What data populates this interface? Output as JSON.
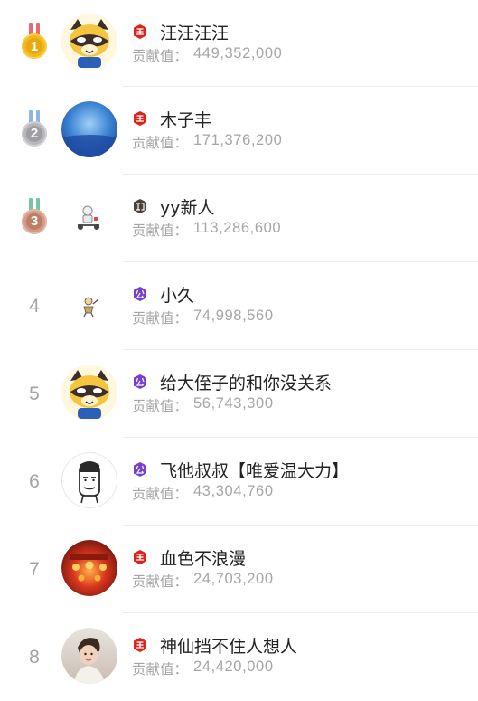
{
  "contribution_label": "贡献值：",
  "entries": [
    {
      "rank": "1",
      "medal": "gold",
      "badge": "king-badge-icon",
      "badge_color": "#d9251d",
      "name": "汪汪汪汪",
      "value": "449,352,000",
      "avatar": "raccoon-mascot-avatar"
    },
    {
      "rank": "2",
      "medal": "silver",
      "badge": "king-badge-icon",
      "badge_color": "#d9251d",
      "name": "木子丰",
      "value": "171,376,200",
      "avatar": "blue-sky-avatar"
    },
    {
      "rank": "3",
      "medal": "bronze",
      "badge": "knight-badge-icon",
      "badge_color": "#4a3f3a",
      "name": "yy新人",
      "value": "113,286,600",
      "avatar": "cartoon-rider-avatar"
    },
    {
      "rank": "4",
      "medal": "",
      "badge": "duke-badge-icon",
      "badge_color": "#7a3fcf",
      "name": "小久",
      "value": "74,998,560",
      "avatar": "cartoon-figure-avatar"
    },
    {
      "rank": "5",
      "medal": "",
      "badge": "duke-badge-icon",
      "badge_color": "#7a3fcf",
      "name": "给大侄子的和你没关系",
      "value": "56,743,300",
      "avatar": "raccoon-mascot-avatar"
    },
    {
      "rank": "6",
      "medal": "",
      "badge": "duke-badge-icon",
      "badge_color": "#7a3fcf",
      "name": "飞他叔叔【唯爱温大力】",
      "value": "43,304,760",
      "avatar": "sketch-face-avatar"
    },
    {
      "rank": "7",
      "medal": "",
      "badge": "king-badge-icon",
      "badge_color": "#d9251d",
      "name": "血色不浪漫",
      "value": "24,703,200",
      "avatar": "red-lanterns-avatar"
    },
    {
      "rank": "8",
      "medal": "",
      "badge": "king-badge-icon",
      "badge_color": "#d9251d",
      "name": "神仙挡不住人想人",
      "value": "24,420,000",
      "avatar": "child-photo-avatar"
    }
  ],
  "colors": {
    "gold": "#f2b820",
    "silver": "#a9a9ad",
    "bronze": "#c88a76",
    "ribbon_gold": "#e66a6f",
    "ribbon_silver": "#8bb6e6",
    "ribbon_bronze": "#77c4a4"
  }
}
